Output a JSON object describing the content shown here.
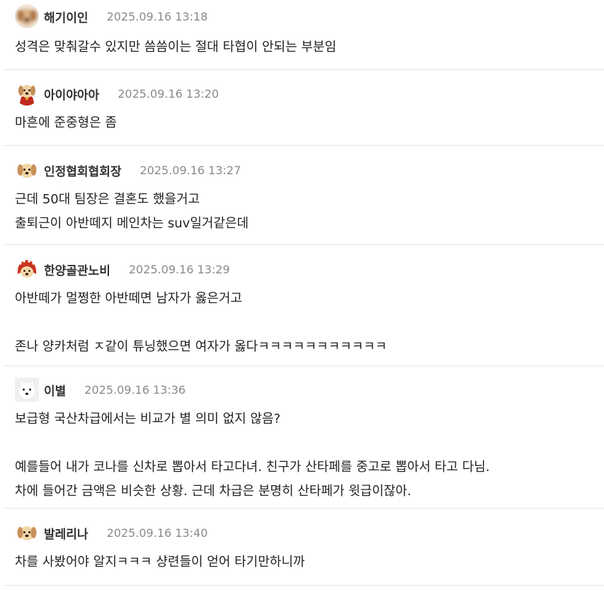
{
  "comments": [
    {
      "nickname": "해기이인",
      "timestamp": "2025.09.16 13:18",
      "avatar": "blurred-puppy-icon",
      "lines": [
        "성격은 맞춰갈수 있지만 씀씀이는 절대 타협이 안되는 부분임"
      ]
    },
    {
      "nickname": "아이야아아",
      "timestamp": "2025.09.16 13:20",
      "avatar": "puppy-red-cape-icon",
      "lines": [
        "마흔에 준중형은 좀"
      ]
    },
    {
      "nickname": "인정협회협회장",
      "timestamp": "2025.09.16 13:27",
      "avatar": "puppy-icon",
      "lines": [
        "근데 50대 팀장은 결혼도 했을거고",
        "출퇴근이 아반떼지 메인차는 suv일거같은데"
      ]
    },
    {
      "nickname": "한양골관노비",
      "timestamp": "2025.09.16 13:29",
      "avatar": "puppy-red-hood-icon",
      "lines": [
        "아반떼가 멀쩡한 아반떼면 남자가 옳은거고",
        "",
        "존나 양카처럼 ㅈ같이 튜닝했으면 여자가 옳다ㅋㅋㅋㅋㅋㅋㅋㅋㅋㅋㅋ"
      ]
    },
    {
      "nickname": "이별",
      "timestamp": "2025.09.16 13:36",
      "avatar": "white-dog-icon",
      "lines": [
        "보급형 국산차급에서는 비교가 별 의미 없지 않음?",
        "",
        "예를들어 내가 코나를 신차로 뽑아서 타고다녀. 친구가 산타페를 중고로 뽑아서 타고 다님.",
        "차에 들어간 금액은 비슷한 상황. 근데 차급은 분명히 산타페가 윗급이잖아."
      ]
    },
    {
      "nickname": "발레리나",
      "timestamp": "2025.09.16 13:40",
      "avatar": "puppy-icon",
      "lines": [
        "차를 사봤어야 알지ㅋㅋㅋ 샹련들이 얻어 타기만하니까"
      ]
    }
  ]
}
